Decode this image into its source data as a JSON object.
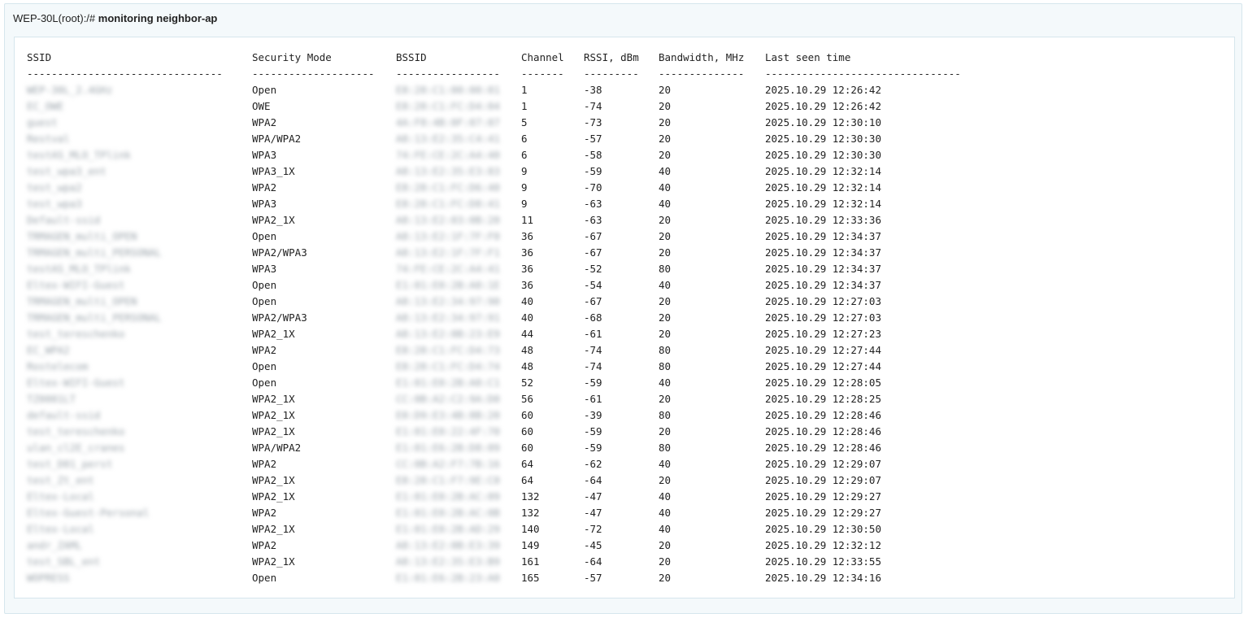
{
  "prompt": {
    "host": "WEP-30L(root):/#",
    "command": "monitoring neighbor-ap"
  },
  "table": {
    "headers": [
      "SSID",
      "Security Mode",
      "BSSID",
      "Channel",
      "RSSI, dBm",
      "Bandwidth, MHz",
      "Last seen time"
    ],
    "separators": [
      "--------------------------------",
      "--------------------",
      "-----------------",
      "-------",
      "---------",
      "--------------",
      "--------------------------------"
    ],
    "rows": [
      {
        "ssid": "WEP-30L_2.4GHz",
        "security": "Open",
        "bssid": "E8:28:C1:00:00:01",
        "channel": "1",
        "rssi": "-38",
        "bandwidth": "20",
        "last_seen": "2025.10.29 12:26:42"
      },
      {
        "ssid": "EC_OWE",
        "security": "OWE",
        "bssid": "E8:28:C1:FC:D4:04",
        "channel": "1",
        "rssi": "-74",
        "bandwidth": "20",
        "last_seen": "2025.10.29 12:26:42"
      },
      {
        "ssid": "guest",
        "security": "WPA2",
        "bssid": "4A:F8:4B:0F:07:07",
        "channel": "5",
        "rssi": "-73",
        "bandwidth": "20",
        "last_seen": "2025.10.29 12:30:10"
      },
      {
        "ssid": "Restval",
        "security": "WPA/WPA2",
        "bssid": "A8:13:E2:35:C4:41",
        "channel": "6",
        "rssi": "-57",
        "bandwidth": "20",
        "last_seen": "2025.10.29 12:30:30"
      },
      {
        "ssid": "testAS_MLO_TPlink",
        "security": "WPA3",
        "bssid": "74:FE:CE:2C:A4:40",
        "channel": "6",
        "rssi": "-58",
        "bandwidth": "20",
        "last_seen": "2025.10.29 12:30:30"
      },
      {
        "ssid": "test_wpa3_ent",
        "security": "WPA3_1X",
        "bssid": "A8:13:E2:35:E3:83",
        "channel": "9",
        "rssi": "-59",
        "bandwidth": "40",
        "last_seen": "2025.10.29 12:32:14"
      },
      {
        "ssid": "test_wpa2",
        "security": "WPA2",
        "bssid": "E8:28:C1:FC:D6:40",
        "channel": "9",
        "rssi": "-70",
        "bandwidth": "40",
        "last_seen": "2025.10.29 12:32:14"
      },
      {
        "ssid": "test_wpa3",
        "security": "WPA3",
        "bssid": "E8:28:C1:FC:D8:41",
        "channel": "9",
        "rssi": "-63",
        "bandwidth": "40",
        "last_seen": "2025.10.29 12:32:14"
      },
      {
        "ssid": "Default-ssid",
        "security": "WPA2_1X",
        "bssid": "A8:13:E2:03:0B:20",
        "channel": "11",
        "rssi": "-63",
        "bandwidth": "20",
        "last_seen": "2025.10.29 12:33:36"
      },
      {
        "ssid": "TRMAGEN_multi_OPEN",
        "security": "Open",
        "bssid": "A8:13:E2:1F:7F:F0",
        "channel": "36",
        "rssi": "-67",
        "bandwidth": "20",
        "last_seen": "2025.10.29 12:34:37"
      },
      {
        "ssid": "TRMAGEN_multi_PERSONAL",
        "security": "WPA2/WPA3",
        "bssid": "A8:13:E2:1F:7F:F1",
        "channel": "36",
        "rssi": "-67",
        "bandwidth": "20",
        "last_seen": "2025.10.29 12:34:37"
      },
      {
        "ssid": "testAS_MLO_TPlink",
        "security": "WPA3",
        "bssid": "74:FE:CE:2C:A4:41",
        "channel": "36",
        "rssi": "-52",
        "bandwidth": "80",
        "last_seen": "2025.10.29 12:34:37"
      },
      {
        "ssid": "Eltex-WIFI-Guest",
        "security": "Open",
        "bssid": "E1:01:E0:2B:A0:1E",
        "channel": "36",
        "rssi": "-54",
        "bandwidth": "40",
        "last_seen": "2025.10.29 12:34:37"
      },
      {
        "ssid": "TRMAGEN_multi_OPEN",
        "security": "Open",
        "bssid": "A8:13:E2:34:97:90",
        "channel": "40",
        "rssi": "-67",
        "bandwidth": "20",
        "last_seen": "2025.10.29 12:27:03"
      },
      {
        "ssid": "TRMAGEN_multi_PERSONAL",
        "security": "WPA2/WPA3",
        "bssid": "A8:13:E2:34:97:91",
        "channel": "40",
        "rssi": "-68",
        "bandwidth": "20",
        "last_seen": "2025.10.29 12:27:03"
      },
      {
        "ssid": "test_tereschenko",
        "security": "WPA2_1X",
        "bssid": "A8:13:E2:0B:23:E9",
        "channel": "44",
        "rssi": "-61",
        "bandwidth": "20",
        "last_seen": "2025.10.29 12:27:23"
      },
      {
        "ssid": "EC_WPA2",
        "security": "WPA2",
        "bssid": "E8:28:C1:FC:D4:73",
        "channel": "48",
        "rssi": "-74",
        "bandwidth": "80",
        "last_seen": "2025.10.29 12:27:44"
      },
      {
        "ssid": "Rostelecom",
        "security": "Open",
        "bssid": "E8:28:C1:FC:D4:74",
        "channel": "48",
        "rssi": "-74",
        "bandwidth": "80",
        "last_seen": "2025.10.29 12:27:44"
      },
      {
        "ssid": "Eltex-WIFI-Guest",
        "security": "Open",
        "bssid": "E1:01:E0:2B:A0:C1",
        "channel": "52",
        "rssi": "-59",
        "bandwidth": "40",
        "last_seen": "2025.10.29 12:28:05"
      },
      {
        "ssid": "TZ0001LT",
        "security": "WPA2_1X",
        "bssid": "CC:0B:A2:C2:9A:D0",
        "channel": "56",
        "rssi": "-61",
        "bandwidth": "20",
        "last_seen": "2025.10.29 12:28:25"
      },
      {
        "ssid": "default-ssid",
        "security": "WPA2_1X",
        "bssid": "E0:D9:E3:4B:8B:20",
        "channel": "60",
        "rssi": "-39",
        "bandwidth": "80",
        "last_seen": "2025.10.29 12:28:46"
      },
      {
        "ssid": "test_tereschenko",
        "security": "WPA2_1X",
        "bssid": "E1:01:E0:22:4F:70",
        "channel": "60",
        "rssi": "-59",
        "bandwidth": "20",
        "last_seen": "2025.10.29 12:28:46"
      },
      {
        "ssid": "ulan_cl2E_cranes",
        "security": "WPA/WPA2",
        "bssid": "E1:01:E6:2B:D8:09",
        "channel": "60",
        "rssi": "-59",
        "bandwidth": "80",
        "last_seen": "2025.10.29 12:28:46"
      },
      {
        "ssid": "test_D01_perst",
        "security": "WPA2",
        "bssid": "CC:0B:A2:F7:7B:16",
        "channel": "64",
        "rssi": "-62",
        "bandwidth": "40",
        "last_seen": "2025.10.29 12:29:07"
      },
      {
        "ssid": "test_Zt_ent",
        "security": "WPA2_1X",
        "bssid": "E8:28:C1:F7:9E:C0",
        "channel": "64",
        "rssi": "-64",
        "bandwidth": "20",
        "last_seen": "2025.10.29 12:29:07"
      },
      {
        "ssid": "Eltex-Local",
        "security": "WPA2_1X",
        "bssid": "E1:01:E0:2B:AC:09",
        "channel": "132",
        "rssi": "-47",
        "bandwidth": "40",
        "last_seen": "2025.10.29 12:29:27"
      },
      {
        "ssid": "Eltex-Guest-Personal",
        "security": "WPA2",
        "bssid": "E1:01:E0:2B:AC:0B",
        "channel": "132",
        "rssi": "-47",
        "bandwidth": "40",
        "last_seen": "2025.10.29 12:29:27"
      },
      {
        "ssid": "Eltex-Local",
        "security": "WPA2_1X",
        "bssid": "E1:01:E0:2B:AD:29",
        "channel": "140",
        "rssi": "-72",
        "bandwidth": "40",
        "last_seen": "2025.10.29 12:30:50"
      },
      {
        "ssid": "andr_ZAML",
        "security": "WPA2",
        "bssid": "A8:13:E2:0B:E3:39",
        "channel": "149",
        "rssi": "-45",
        "bandwidth": "20",
        "last_seen": "2025.10.29 12:32:12"
      },
      {
        "ssid": "test_SBL_ent",
        "security": "WPA2_1X",
        "bssid": "A8:13:E2:35:E3:B9",
        "channel": "161",
        "rssi": "-64",
        "bandwidth": "20",
        "last_seen": "2025.10.29 12:33:55"
      },
      {
        "ssid": "WOPRESS",
        "security": "Open",
        "bssid": "E1:01:E6:2B:23:A0",
        "channel": "165",
        "rssi": "-57",
        "bandwidth": "20",
        "last_seen": "2025.10.29 12:34:16"
      }
    ]
  }
}
